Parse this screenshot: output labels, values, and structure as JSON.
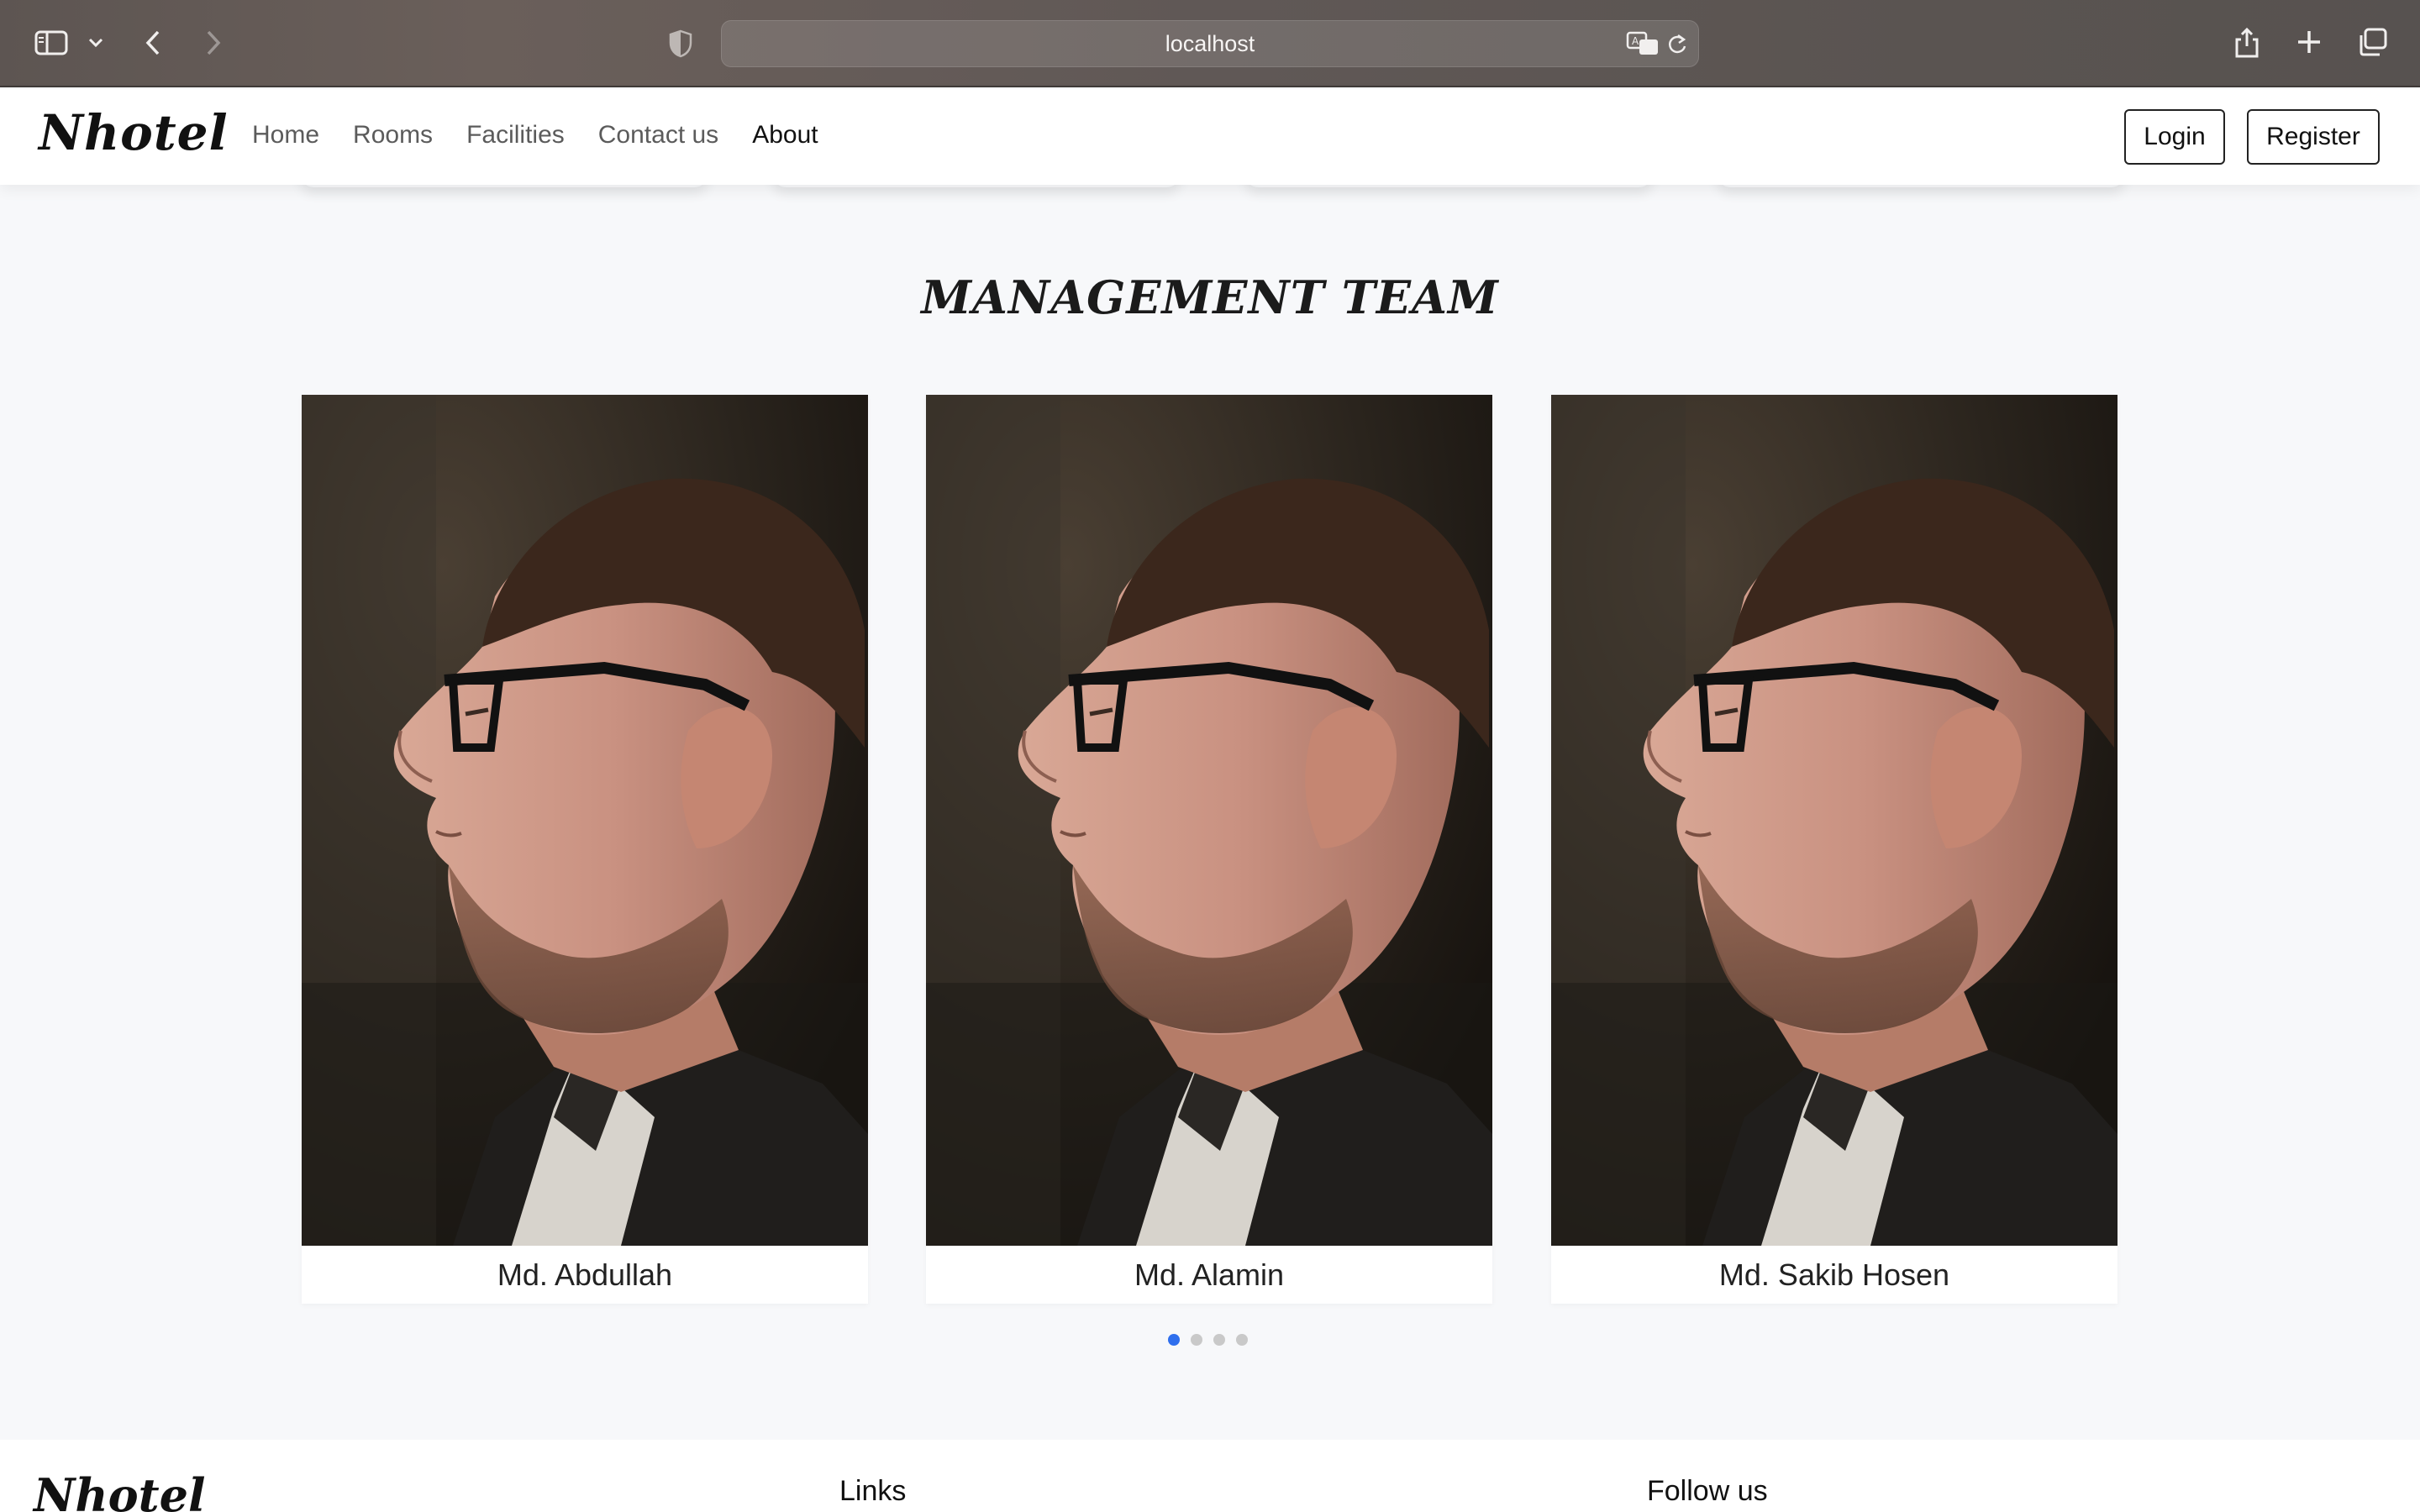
{
  "browser": {
    "url": "localhost"
  },
  "navbar": {
    "brand": "Nhotel",
    "links": [
      {
        "label": "Home",
        "active": false
      },
      {
        "label": "Rooms",
        "active": false
      },
      {
        "label": "Facilities",
        "active": false
      },
      {
        "label": "Contact us",
        "active": false
      },
      {
        "label": "About",
        "active": true
      }
    ],
    "login_label": "Login",
    "register_label": "Register"
  },
  "team": {
    "title": "MANAGEMENT TEAM",
    "members": [
      {
        "name": "Md. Abdullah"
      },
      {
        "name": "Md. Alamin"
      },
      {
        "name": "Md. Sakib Hosen"
      }
    ],
    "carousel": {
      "total_pages": 4,
      "active_index": 0
    }
  },
  "footer": {
    "brand": "Nhotel",
    "links_heading": "Links",
    "follow_heading": "Follow us"
  },
  "colors": {
    "accent": "#2f6fed",
    "page_bg": "#f7f8fa"
  }
}
